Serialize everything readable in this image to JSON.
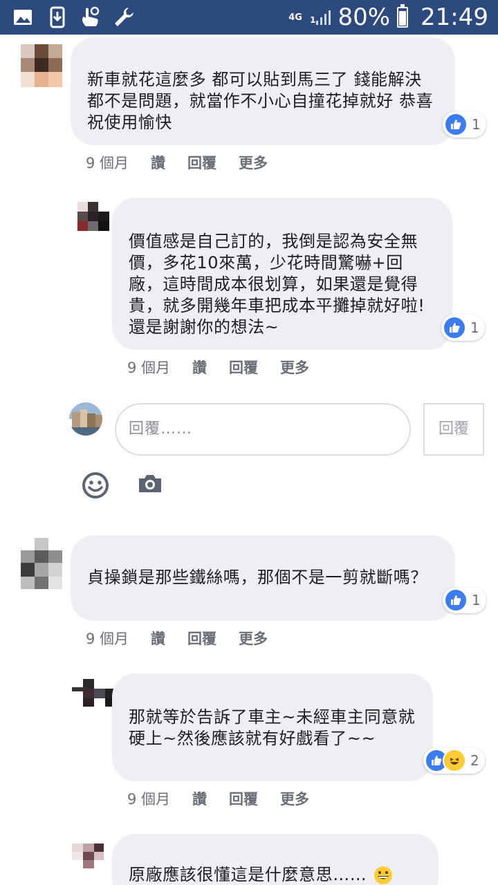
{
  "status_bar": {
    "network": "4G",
    "signal_sub": "1",
    "battery": "80%",
    "battery_level": 0.8,
    "time": "21:49",
    "left_icons": [
      "image-icon",
      "download-icon",
      "touch-icon",
      "wrench-icon"
    ]
  },
  "comments": [
    {
      "text": "新車就花這麼多 都可以貼到馬三了 錢能解決都不是問題，就當作不小心自撞花掉就好 恭喜 祝使用愉快",
      "time": "9 個月",
      "like": "讚",
      "reply": "回覆",
      "more": "更多",
      "reaction_count": "1"
    },
    {
      "text": "價值感是自己訂的，我倒是認為安全無價，多花10來萬，少花時間驚嚇+回廠，這時間成本很划算，如果還是覺得貴，就多開幾年車把成本平攤掉就好啦!還是謝謝你的想法~",
      "time": "9 個月",
      "like": "讚",
      "reply": "回覆",
      "more": "更多",
      "reaction_count": "1"
    },
    {
      "text": "貞操鎖是那些鐵絲嗎，那個不是一剪就斷嗎？",
      "time": "9 個月",
      "like": "讚",
      "reply": "回覆",
      "more": "更多",
      "reaction_count": "1"
    },
    {
      "text": "那就等於告訴了車主~未經車主同意就硬上~然後應該就有好戲看了~~",
      "time": "9 個月",
      "like": "讚",
      "reply": "回覆",
      "more": "更多",
      "reaction_count": "2"
    },
    {
      "text": "原廠應該很懂這是什麼意思……"
    }
  ],
  "reply_box": {
    "placeholder": "回覆……",
    "button": "回覆"
  },
  "colors": {
    "status_bar": "#2c4a7e",
    "bubble": "#edeff2",
    "like": "#3b7df0"
  }
}
